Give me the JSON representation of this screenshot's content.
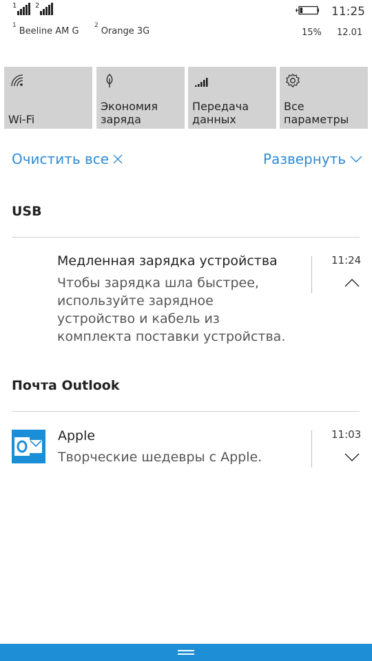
{
  "status_bar": {
    "sim1_index": "1",
    "sim2_index": "1",
    "sim2_label_index": "2",
    "sim1_label_index": "1",
    "carrier1": "Beeline AM G",
    "carrier2": "Orange 3G",
    "time": "11:25",
    "battery": "15%",
    "date": "12.01",
    "battery_level": 0.15
  },
  "quick_actions": [
    {
      "label": "Wi-Fi",
      "icon": "wifi-icon"
    },
    {
      "label": "Экономия заряда",
      "icon": "battery-saver-icon"
    },
    {
      "label": "Передача данных",
      "icon": "cellular-data-icon"
    },
    {
      "label": "Все параметры",
      "icon": "settings-icon"
    }
  ],
  "actions": {
    "clear_all": "Очистить все",
    "expand": "Развернуть"
  },
  "groups": [
    {
      "title": "USB",
      "notification": {
        "title": "Медленная зарядка устройства",
        "body_lines": [
          "Чтобы зарядка шла быстрее,",
          "используйте зарядное",
          "устройство и кабель из",
          "комплекта поставки устройства."
        ],
        "time": "11:24"
      }
    },
    {
      "title": "Почта Outlook",
      "notification": {
        "title": "Apple",
        "body": "Творческие шедевры с Apple.",
        "time": "11:03",
        "icon": "outlook-icon"
      }
    }
  ],
  "colors": {
    "accent": "#2f8ad3",
    "tile_bg": "#d2d2d2",
    "bottom_bar": "#1e8fd6"
  }
}
